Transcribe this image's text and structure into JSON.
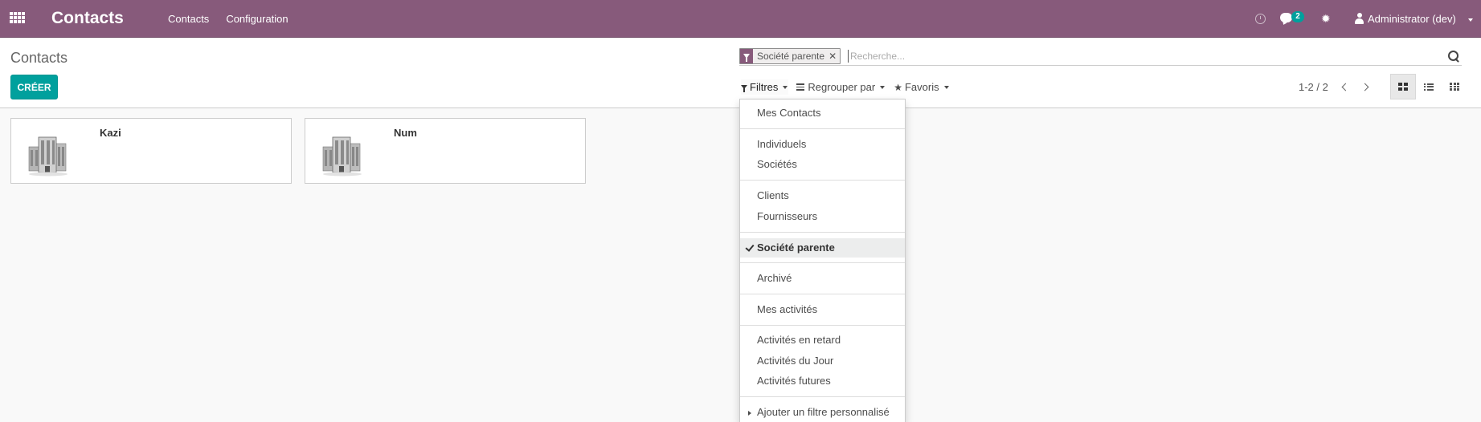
{
  "navbar": {
    "brand": "Contacts",
    "menu": [
      "Contacts",
      "Configuration"
    ],
    "chat_badge": "2",
    "user_name": "Administrator (dev)",
    "color": "#875a7b"
  },
  "control_panel": {
    "breadcrumb": "Contacts",
    "create_label": "CRÉER",
    "search": {
      "facet_label": "Société parente",
      "placeholder": "Recherche..."
    },
    "options": {
      "filters": "Filtres",
      "group_by": "Regrouper par",
      "favorites": "Favoris"
    },
    "pager": "1-2 / 2",
    "views": [
      "kanban",
      "list",
      "grid"
    ],
    "active_view": "kanban"
  },
  "kanban": {
    "cards": [
      {
        "name": "Kazi",
        "image": "company-icon"
      },
      {
        "name": "Num",
        "image": "company-icon"
      }
    ]
  },
  "filters_menu": {
    "groups": [
      [
        "Mes Contacts"
      ],
      [
        "Individuels",
        "Sociétés"
      ],
      [
        "Clients",
        "Fournisseurs"
      ],
      [
        "Société parente"
      ],
      [
        "Archivé"
      ],
      [
        "Mes activités"
      ],
      [
        "Activités en retard",
        "Activités du Jour",
        "Activités futures"
      ],
      [
        "Ajouter un filtre personnalisé"
      ]
    ],
    "selected": "Société parente"
  },
  "colors": {
    "accent": "#00a09d",
    "brand": "#875a7b"
  }
}
